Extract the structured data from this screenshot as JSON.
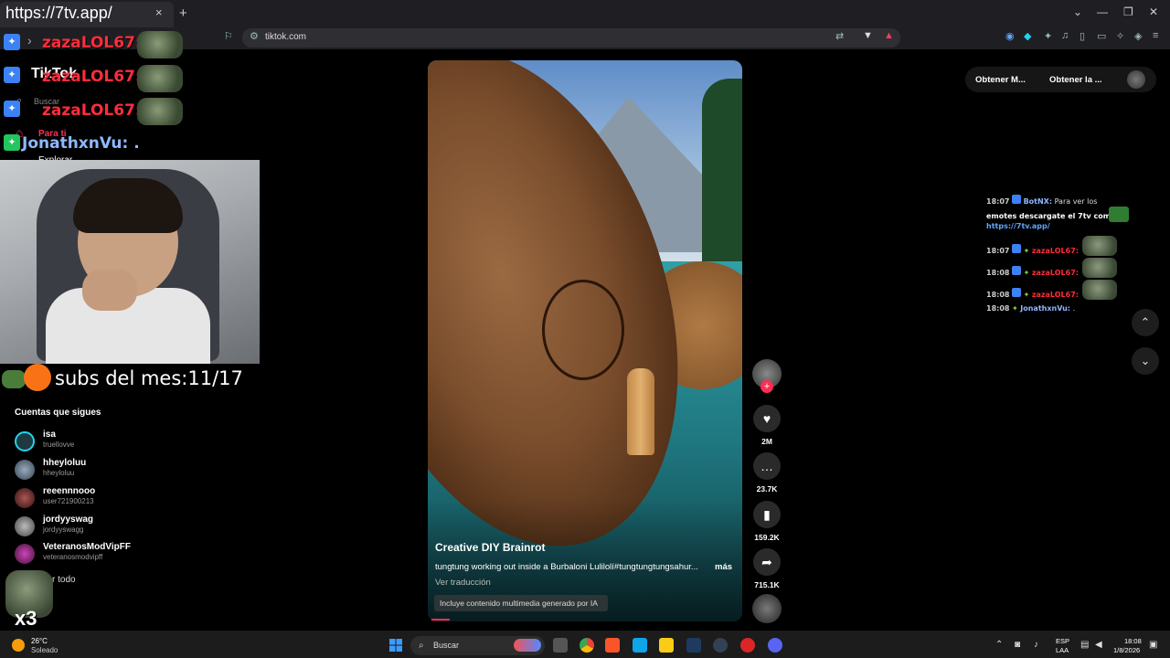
{
  "browser": {
    "tab_title": "https://7tv.app/",
    "tab_close": "×",
    "new_tab": "+",
    "url": "tiktok.com",
    "win_controls": [
      "⌄",
      "—",
      "❐",
      "✕"
    ]
  },
  "overlay_chat": [
    {
      "name": "zazaLOL67:",
      "color": "#ff2d3b"
    },
    {
      "name": "zazaLOL67:",
      "color": "#ff2d3b"
    },
    {
      "name": "zazaLOL67:",
      "color": "#ff2d3b"
    },
    {
      "name": "JonathxnVu: .",
      "color": "#8fb8ff"
    }
  ],
  "sidebar": {
    "logo": "TikTok",
    "search_placeholder": "Buscar",
    "para_ti": "Para ti",
    "explorar": "Explorar",
    "following_title": "Cuentas que sigues",
    "accounts": [
      {
        "name": "isa",
        "handle": "truellovve"
      },
      {
        "name": "hheyloluu",
        "handle": "hheyloluu"
      },
      {
        "name": "reeennnooo",
        "handle": "user721900213"
      },
      {
        "name": "jordyyswag",
        "handle": "jordyyswagg"
      },
      {
        "name": "VeteranosModVipFF",
        "handle": "veteranosmodvipff"
      }
    ],
    "see_all": "r todo"
  },
  "overlay": {
    "subs": "subs del mes:11/17",
    "multiplier": "x3"
  },
  "video": {
    "author": "Creative DIY Brainrot",
    "description": "tungtung working out inside a Burbaloni Lulilolí#tungtungtungsahur...",
    "more": "más",
    "translate": "Ver traducción",
    "ai_notice": "Incluye contenido multimedia generado por IA"
  },
  "actions": {
    "likes": "2M",
    "comments": "23.7K",
    "saves": "159.2K",
    "shares": "715.1K"
  },
  "topright": {
    "get_app_1": "Obtener M...",
    "get_app_2": "Obtener la ..."
  },
  "right_chat": [
    {
      "time": "18:07",
      "name": "BotNX:",
      "text": "Para ver los"
    },
    {
      "time": "",
      "name": "",
      "text": "emotes descargate el 7tv compi"
    },
    {
      "time": "",
      "name": "",
      "text": "https://7tv.app/"
    },
    {
      "time": "18:07",
      "name": "zazaLOL67:",
      "text": ""
    },
    {
      "time": "18:08",
      "name": "zazaLOL67:",
      "text": ""
    },
    {
      "time": "18:08",
      "name": "zazaLOL67:",
      "text": ""
    },
    {
      "time": "18:08",
      "name": "JonathxnVu:",
      "text": "."
    }
  ],
  "taskbar": {
    "temp": "26°C",
    "weather": "Soleado",
    "search": "Buscar",
    "lang1": "ESP",
    "lang2": "LAA",
    "time": "18:08",
    "date": "1/8/2026"
  }
}
